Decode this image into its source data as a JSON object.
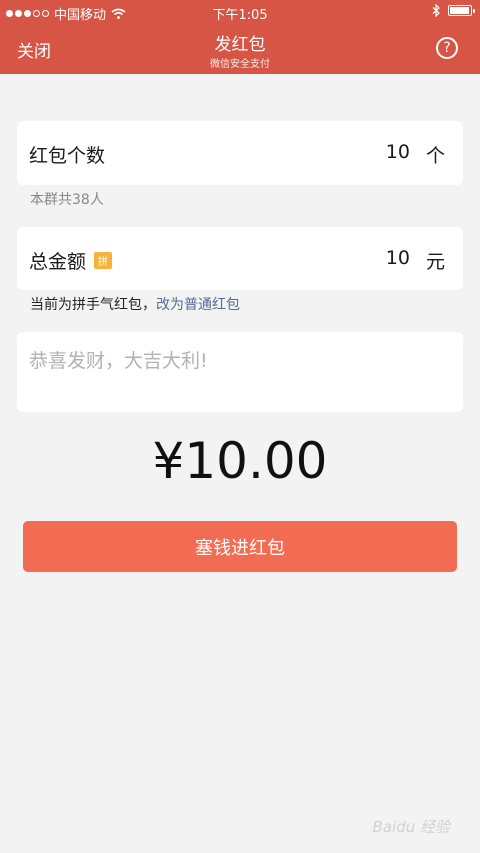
{
  "status_bar": {
    "carrier": "中国移动",
    "time": "下午1:05",
    "signal_filled": 3,
    "signal_total": 5
  },
  "header": {
    "close_label": "关闭",
    "title": "发红包",
    "subtitle": "微信安全支付",
    "help_symbol": "?"
  },
  "count_row": {
    "label": "红包个数",
    "value": "10",
    "unit": "个"
  },
  "count_note": "本群共38人",
  "amount_row": {
    "label": "总金额",
    "badge": "拼",
    "value": "10",
    "unit": "元"
  },
  "mode_note": {
    "text": "当前为拼手气红包，",
    "link": "改为普通红包"
  },
  "message": {
    "placeholder": "恭喜发财，大吉大利!"
  },
  "total_display": "¥10.00",
  "submit_label": "塞钱进红包",
  "watermark": "Baidu 经验",
  "colors": {
    "header_bg": "#d65544",
    "button_bg": "#f26c54",
    "link": "#576b95",
    "badge": "#f5b33b"
  }
}
